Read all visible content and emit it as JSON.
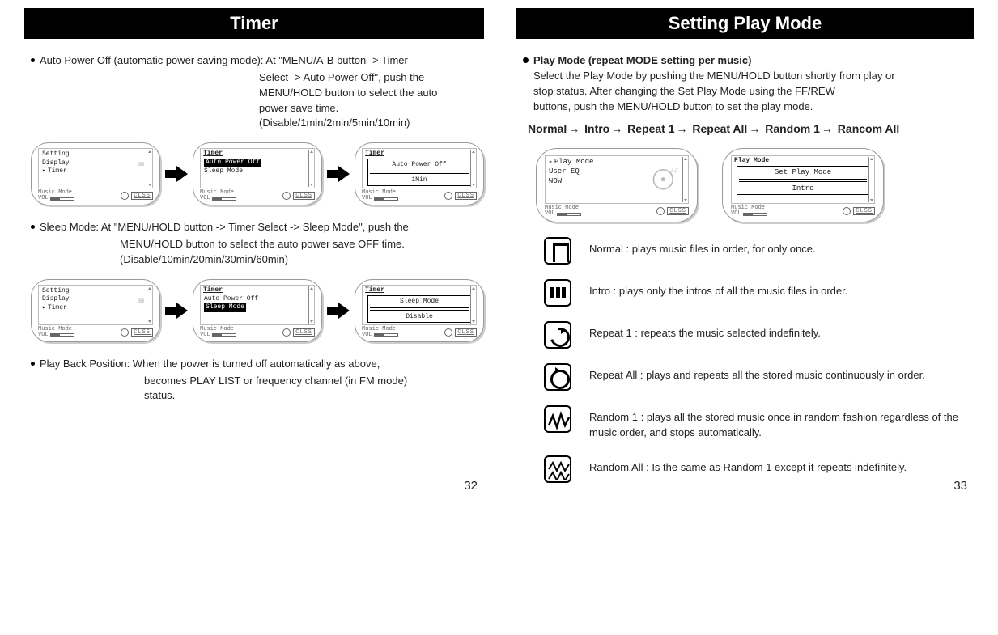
{
  "left": {
    "title": "Timer",
    "autoPowerOff": {
      "lead": "Auto Power Off (automatic power saving mode): At \"MENU/A-B button -> Timer",
      "l2": "Select  -> Auto Power Off\", push the",
      "l3": "MENU/HOLD button to select the auto",
      "l4": "power save time.",
      "l5": "(Disable/1min/2min/5min/10min)"
    },
    "sleepMode": {
      "lead": "Sleep Mode: At \"MENU/HOLD button -> Timer Select -> Sleep Mode\", push the",
      "l2": "MENU/HOLD  button to select the auto power save OFF time.",
      "l3": "(Disable/10min/20min/30min/60min)"
    },
    "playBack": {
      "lead": "Play Back Position: When the power is turned off automatically as above,",
      "l2": "becomes PLAY LIST or frequency channel (in FM mode)",
      "l3": "status."
    },
    "screenRow1": {
      "s1": {
        "items": [
          "Setting",
          "Display",
          "Timer"
        ],
        "selIndex": 2
      },
      "s2": {
        "title": "Timer",
        "items": [
          "Auto Power Off",
          "Sleep Mode"
        ],
        "hiIndex": 0
      },
      "s3": {
        "title": "Timer",
        "sliderLabel": "Auto Power Off",
        "sliderValue": "1Min"
      }
    },
    "screenRow2": {
      "s1": {
        "items": [
          "Setting",
          "Display",
          "Timer"
        ],
        "selIndex": 2
      },
      "s2": {
        "title": "Timer",
        "items": [
          "Auto Power Off",
          "Sleep Mode"
        ],
        "hiIndex": 1
      },
      "s3": {
        "title": "Timer",
        "sliderLabel": "Sleep Mode",
        "sliderValue": "Disable"
      }
    },
    "footer": {
      "mode": "Music Mode",
      "vol": "VOL",
      "clss": "CLSS"
    },
    "pageNum": "32"
  },
  "right": {
    "title": "Setting Play Mode",
    "intro": {
      "head": "Play Mode (repeat MODE setting per music)",
      "l1": "Select the Play Mode by pushing the MENU/HOLD button shortly from play or",
      "l2": "stop status.  After changing the Set Play Mode using the FF/REW",
      "l3": "buttons, push the MENU/HOLD button to set the play mode."
    },
    "sequence": [
      "Normal",
      "Intro",
      "Repeat 1",
      "Repeat All",
      "Random 1",
      "Rancom All"
    ],
    "arrow": "→",
    "screens": {
      "s1": {
        "items": [
          "Play Mode",
          "User EQ",
          "WOW"
        ],
        "selIndex": 0
      },
      "s2": {
        "title": "Play Mode",
        "sliderLabel": "Set Play Mode",
        "sliderValue": "Intro"
      }
    },
    "modes": [
      {
        "icon": "normal",
        "text": "Normal : plays music files in order, for only once."
      },
      {
        "icon": "intro",
        "text": "Intro : plays only the intros of all the music files in order."
      },
      {
        "icon": "rep1",
        "text": "Repeat 1 : repeats the music selected indefinitely."
      },
      {
        "icon": "repall",
        "text": "Repeat All : plays and repeats all the stored music continuously in order."
      },
      {
        "icon": "rand1",
        "text": "Random 1 : plays all the stored music once in random fashion regardless of the music order, and stops automatically."
      },
      {
        "icon": "randall",
        "text": "Random All : Is the same as Random 1 except it repeats indefinitely."
      }
    ],
    "footer": {
      "mode": "Music Mode",
      "vol": "VOL",
      "clss": "CLSS"
    },
    "pageNum": "33"
  }
}
